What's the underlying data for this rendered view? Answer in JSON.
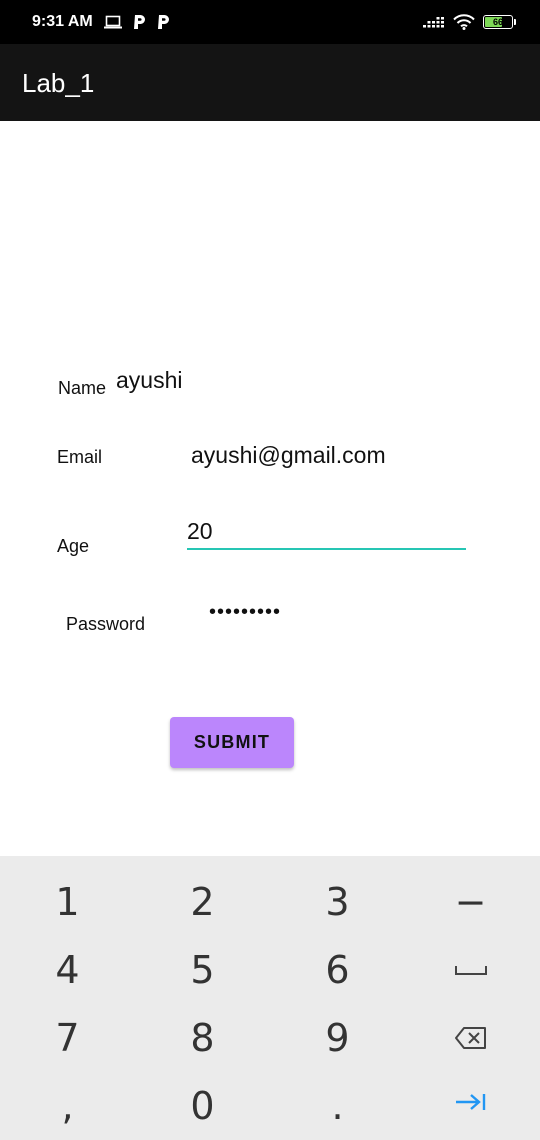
{
  "status_bar": {
    "time": "9:31 AM",
    "battery_level": "66",
    "battery_color": "#7ed957",
    "icons": [
      "laptop-icon",
      "p-icon",
      "p-icon",
      "signal-icon",
      "wifi-icon",
      "battery-icon"
    ]
  },
  "app_bar": {
    "title": "Lab_1"
  },
  "form": {
    "name_label": "Name",
    "name_value": "ayushi",
    "email_label": "Email",
    "email_value": "ayushi@gmail.com",
    "age_label": "Age",
    "age_value": "20",
    "password_label": "Password",
    "password_value": "•••••••••",
    "submit_label": "SUBMIT"
  },
  "colors": {
    "accent": "#26c6b4",
    "button": "#bb86fc",
    "toolbar": "#141414",
    "keyboard_bg": "#ebebeb",
    "enter_key": "#2196f3"
  },
  "keyboard": {
    "row1": [
      "1",
      "2",
      "3",
      "−"
    ],
    "row2": [
      "4",
      "5",
      "6",
      "space-icon"
    ],
    "row3": [
      "7",
      "8",
      "9",
      "backspace-icon"
    ],
    "row4": [
      ",",
      "0",
      ".",
      "enter-icon"
    ]
  }
}
